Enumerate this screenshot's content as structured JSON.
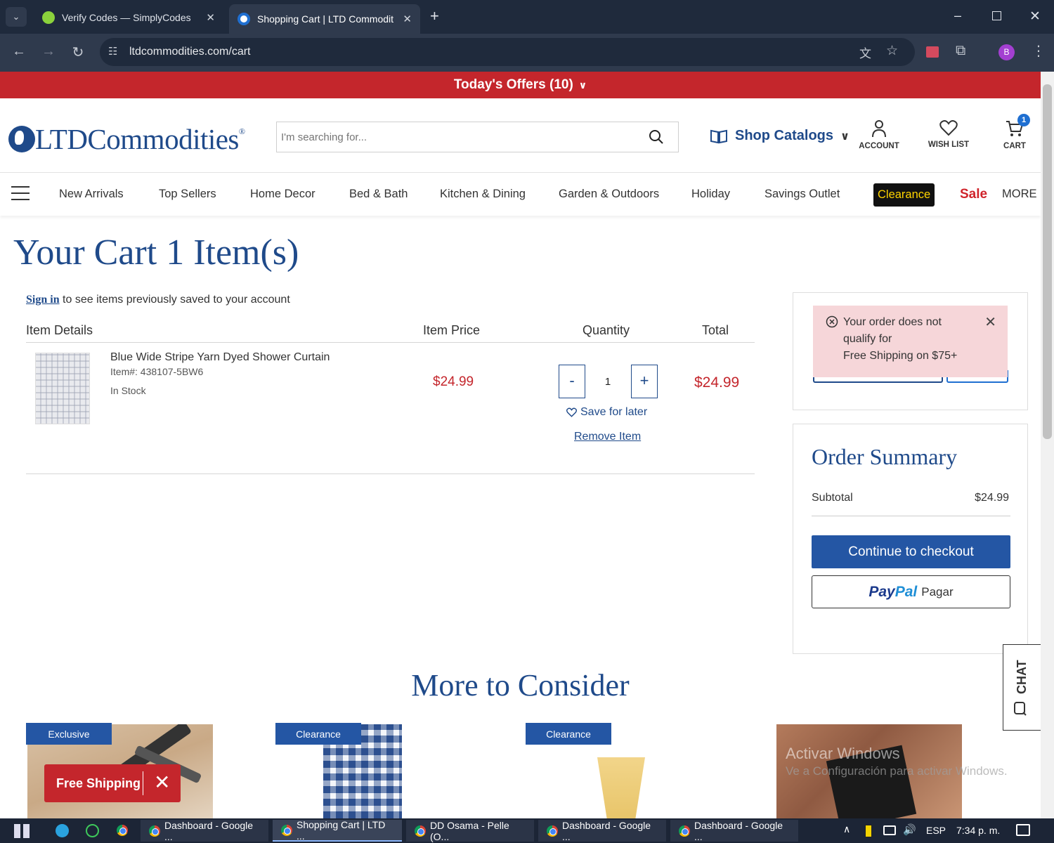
{
  "browser": {
    "tabs": [
      {
        "title": "Verify Codes — SimplyCodes",
        "active": false
      },
      {
        "title": "Shopping Cart | LTD Commodit",
        "active": true
      }
    ],
    "url": "ltdcommodities.com/cart",
    "profile_initial": "B"
  },
  "banner": {
    "offers_label": "Today's Offers (10)"
  },
  "header": {
    "logo_text": "LTDCommodities",
    "logo_mark": "®",
    "search_placeholder": "I'm searching for...",
    "shop_catalogs": "Shop Catalogs",
    "account": "ACCOUNT",
    "wishlist": "WISH LIST",
    "cart": "CART",
    "cart_count": "1"
  },
  "nav": {
    "items": [
      "New Arrivals",
      "Top Sellers",
      "Home Decor",
      "Bed & Bath",
      "Kitchen & Dining",
      "Garden & Outdoors",
      "Holiday",
      "Savings Outlet"
    ],
    "clearance": "Clearance",
    "sale": "Sale",
    "more": "MORE"
  },
  "cart": {
    "title": "Your Cart 1 Item(s)",
    "signin_link": "Sign in",
    "signin_text": " to see items previously saved to your account",
    "columns": {
      "details": "Item Details",
      "price": "Item Price",
      "quantity": "Quantity",
      "total": "Total"
    },
    "item": {
      "name": "Blue Wide Stripe Yarn Dyed Shower Curtain",
      "sku": "Item#: 438107-5BW6",
      "stock": "In Stock",
      "price": "$24.99",
      "quantity": "1",
      "total": "$24.99",
      "minus": "-",
      "plus": "+",
      "save_later": "Save for later",
      "remove": "Remove Item"
    }
  },
  "alert": {
    "line1": "Your order does not",
    "line2": "qualify for",
    "line3": "Free Shipping on $75+"
  },
  "summary": {
    "title": "Order Summary",
    "subtotal_label": "Subtotal",
    "subtotal_value": "$24.99",
    "checkout": "Continue to checkout",
    "paypal_pay": "Pay",
    "paypal_pal": "Pal",
    "paypal_pagar": "Pagar"
  },
  "chat": "CHAT",
  "more_to_consider": {
    "title": "More to Consider",
    "badges": [
      "Exclusive",
      "Clearance",
      "Clearance"
    ]
  },
  "free_shipping": "Free Shipping",
  "watermark": {
    "line1": "Activar Windows",
    "line2": "Ve a Configuración para activar Windows."
  },
  "taskbar": {
    "items": [
      "Dashboard - Google ...",
      "Shopping Cart | LTD ...",
      "DD Osama - Pelle (O...",
      "Dashboard - Google ...",
      "Dashboard - Google ..."
    ],
    "lang": "ESP",
    "time": "7:34 p. m."
  }
}
